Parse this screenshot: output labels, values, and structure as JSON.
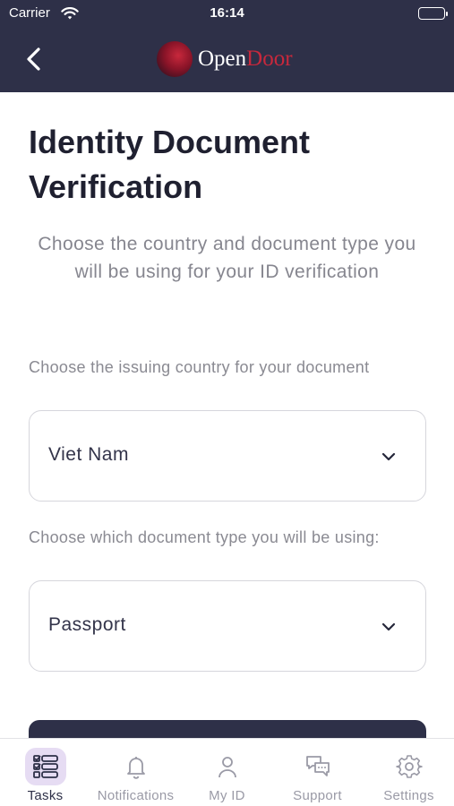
{
  "status_bar": {
    "carrier": "Carrier",
    "time": "16:14"
  },
  "header": {
    "logo_open": "Open",
    "logo_door": "Door",
    "icons": {
      "back": "chevron-left-icon"
    }
  },
  "main": {
    "title": "Identity Document Verification",
    "intro": "Choose the country and document type you will be using for your ID verification",
    "country_label": "Choose the issuing country for your document",
    "country_value": "Viet Nam",
    "doctype_label": "Choose which document type you will be using:",
    "doctype_value": "Passport"
  },
  "tabbar": {
    "tabs": [
      {
        "label": "Tasks",
        "icon": "tasks-icon",
        "active": true
      },
      {
        "label": "Notifications",
        "icon": "bell-icon",
        "active": false
      },
      {
        "label": "My ID",
        "icon": "person-icon",
        "active": false
      },
      {
        "label": "Support",
        "icon": "chat-bubbles-icon",
        "active": false
      },
      {
        "label": "Settings",
        "icon": "gear-icon",
        "active": false
      }
    ]
  },
  "colors": {
    "header_bg": "#2e3048",
    "brand_red": "#c8283c",
    "active_tab_bg": "#e6dcf3"
  }
}
